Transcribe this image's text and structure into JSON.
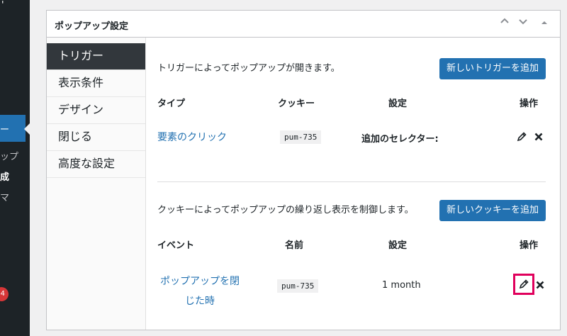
{
  "sidebar": {
    "top_glyph": "'",
    "active_glyph": "ー",
    "sub_items": [
      {
        "label": "ップ",
        "bold": false
      },
      {
        "label": "成",
        "bold": true
      },
      {
        "label": "マ",
        "bold": false
      }
    ],
    "badge_count": "4"
  },
  "metabox": {
    "title": "ポップアップ設定",
    "controls": [
      "move-up",
      "move-down",
      "toggle"
    ]
  },
  "tabs": [
    {
      "label": "トリガー",
      "active": true
    },
    {
      "label": "表示条件",
      "active": false
    },
    {
      "label": "デザイン",
      "active": false
    },
    {
      "label": "閉じる",
      "active": false
    },
    {
      "label": "高度な設定",
      "active": false
    }
  ],
  "triggers": {
    "description": "トリガーによってポップアップが開きます。",
    "add_button": "新しいトリガーを追加",
    "headers": {
      "type": "タイプ",
      "cookie": "クッキー",
      "settings": "設定",
      "actions": "操作"
    },
    "row": {
      "type": "要素のクリック",
      "cookie": "pum-735",
      "settings": "追加のセレクター:"
    }
  },
  "cookies": {
    "description": "クッキーによってポップアップの繰り返し表示を制御します。",
    "add_button": "新しいクッキーを追加",
    "headers": {
      "event": "イベント",
      "name": "名前",
      "settings": "設定",
      "actions": "操作"
    },
    "row": {
      "event_line1": "ポップアップを閉",
      "event_line2": "じた時",
      "name": "pum-735",
      "settings": "1 month"
    }
  },
  "colors": {
    "primary": "#2271b1",
    "highlight": "#e0005c",
    "sidebar": "#1d2327"
  }
}
